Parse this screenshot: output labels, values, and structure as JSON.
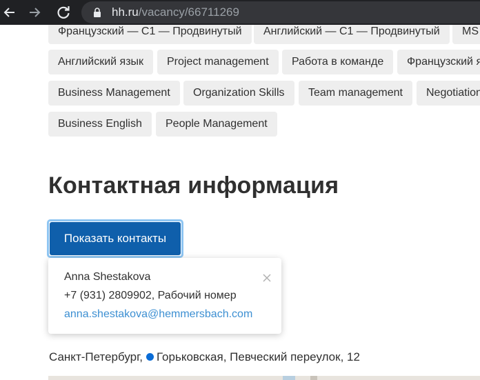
{
  "browser": {
    "url_host": "hh.ru",
    "url_path": "/vacancy/66711269"
  },
  "skills": {
    "row0": [
      "Французский — C1 — Продвинутый",
      "Английский — C1 — Продвинутый",
      "MS"
    ],
    "row1": [
      "Английский язык",
      "Project management",
      "Работа в команде",
      "Французский я"
    ],
    "row2": [
      "Business Management",
      "Organization Skills",
      "Team management",
      "Negotiation"
    ],
    "row3": [
      "Business English",
      "People Management"
    ]
  },
  "contacts": {
    "section_title": "Контактная информация",
    "show_button_label": "Показать контакты",
    "popup": {
      "name": "Anna Shestakova",
      "phone": "+7 (931) 2809902, Рабочий номер",
      "email": "anna.shestakova@hemmersbach.com"
    }
  },
  "address": {
    "city": "Санкт-Петербург,",
    "metro_color": "#0a6cd6",
    "details": "Горьковская, Певческий переулок, 12"
  }
}
